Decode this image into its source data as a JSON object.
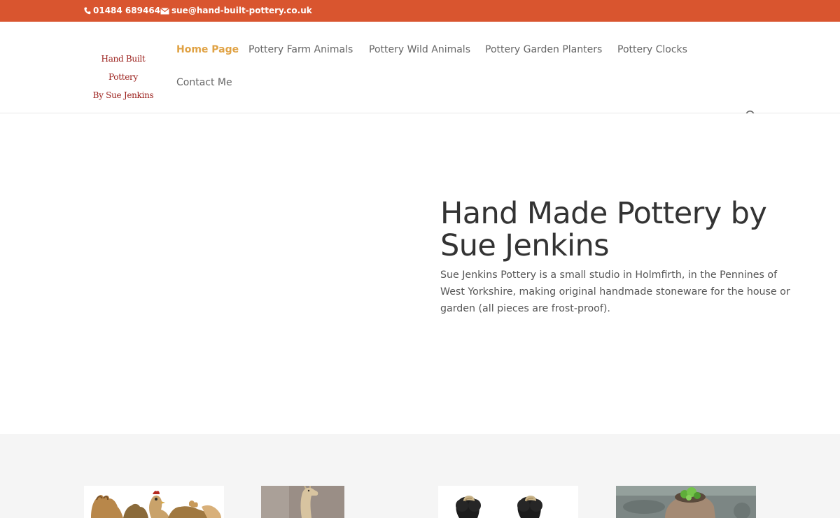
{
  "topbar": {
    "phone": "01484 689464",
    "email": "sue@hand-built-pottery.co.uk",
    "phone_icon": "phone-icon",
    "email_icon": "envelope-icon",
    "bar_color": "#d9552f"
  },
  "logo": {
    "line1": "Hand Built Pottery",
    "line2": "By Sue Jenkins"
  },
  "nav": {
    "items": [
      {
        "label": "Home Page",
        "active": true
      },
      {
        "label": "Pottery Farm Animals"
      },
      {
        "label": "Pottery Wild Animals"
      },
      {
        "label": "Pottery Garden Planters"
      },
      {
        "label": "Pottery Clocks"
      },
      {
        "label": "Contact Me"
      }
    ],
    "active_color": "#e0a244",
    "search_icon": "search-icon"
  },
  "hero": {
    "title": "Hand Made Pottery by Sue Jenkins",
    "text": "Sue Jenkins Pottery is a small studio in Holmfirth, in the Pennines of West Yorkshire, making original handmade stoneware for the house or garden (all pieces are frost-proof)."
  },
  "gallery": {
    "thumbnails": [
      "pottery-hens-image",
      "pottery-camel-image",
      "pottery-sheep-image",
      "pottery-planter-image"
    ]
  }
}
